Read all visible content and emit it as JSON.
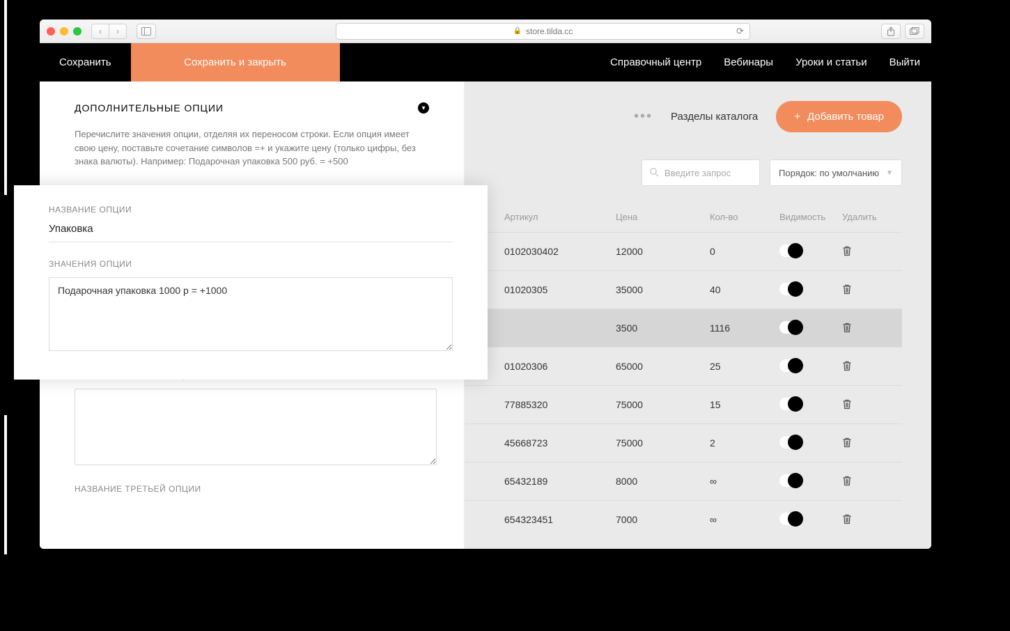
{
  "browser": {
    "url_label": "store.tilda.cc"
  },
  "topbar": {
    "save": "Сохранить",
    "save_close": "Сохранить и закрыть",
    "help": "Справочный центр",
    "webinars": "Вебинары",
    "lessons": "Уроки и статьи",
    "logout": "Выйти"
  },
  "options": {
    "heading": "ДОПОЛНИТЕЛЬНЫЕ ОПЦИИ",
    "description": "Перечислите значения опции, отделяя их переносом строки. Если опция имеет свою цену, поставьте сочетание символов =+ и укажите цену (только цифры, без знака валюты). Например: Подарочная упаковка 500 руб. = +500",
    "name_label": "НАЗВАНИЕ ОПЦИИ",
    "name_value": "Упаковка",
    "values_label": "ЗНАЧЕНИЯ ОПЦИИ",
    "values_text": "Подарочная упаковка 1000 р = +1000",
    "second_values_label": "ЗНАЧЕНИЯ ВТОРОЙ ОПЦИИ",
    "third_name_label": "НАЗВАНИЕ ТРЕТЬЕЙ ОПЦИИ"
  },
  "catalog": {
    "sections_link": "Разделы каталога",
    "add_product": "Добавить товар",
    "search_placeholder": "Введите запрос",
    "sort_label": "Порядок: по умолчанию",
    "columns": {
      "sku": "Артикул",
      "price": "Цена",
      "qty": "Кол-во",
      "visibility": "Видимость",
      "delete": "Удалить"
    },
    "rows": [
      {
        "sku": "0102030402",
        "price": "12000",
        "qty": "0",
        "selected": false
      },
      {
        "sku": "01020305",
        "price": "35000",
        "qty": "40",
        "selected": false
      },
      {
        "sku": "",
        "price": "3500",
        "qty": "1116",
        "selected": true
      },
      {
        "sku": "01020306",
        "price": "65000",
        "qty": "25",
        "selected": false
      },
      {
        "sku": "77885320",
        "price": "75000",
        "qty": "15",
        "selected": false
      },
      {
        "sku": "45668723",
        "price": "75000",
        "qty": "2",
        "selected": false
      },
      {
        "sku": "65432189",
        "price": "8000",
        "qty": "∞",
        "selected": false
      },
      {
        "sku": "654323451",
        "price": "7000",
        "qty": "∞",
        "selected": false
      }
    ]
  }
}
